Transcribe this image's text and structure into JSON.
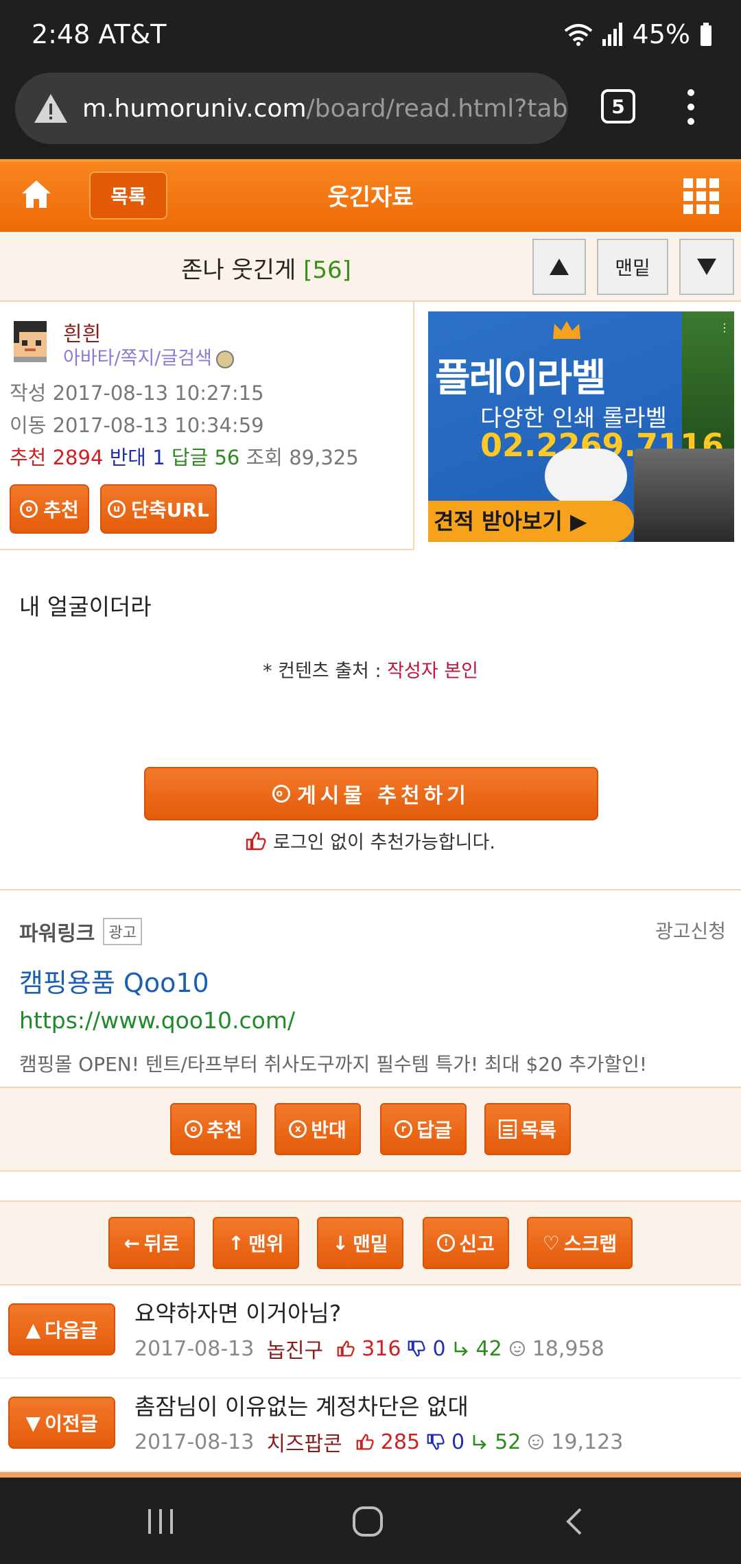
{
  "status": {
    "time": "2:48 AT&T",
    "battery": "45%"
  },
  "browser": {
    "url_host": "m.humoruniv.com",
    "url_path": "/board/read.html?table",
    "tab_count": "5"
  },
  "header": {
    "list_label": "목록",
    "title": "웃긴자료"
  },
  "post": {
    "title": "존나 웃긴게",
    "reply_count": "[56]",
    "nav_bottom": "맨밑",
    "author": "흰흰",
    "author_links": "아바타/쪽지/글검색",
    "created_label": "작성",
    "created": "2017-08-13 10:27:15",
    "moved_label": "이동",
    "moved": "2017-08-13 10:34:59",
    "rec_label": "추천",
    "rec": "2894",
    "opp_label": "반대",
    "opp": "1",
    "reply_label": "답글",
    "reply": "56",
    "views_label": "조회",
    "views": "89,325",
    "btn_recommend": "추천",
    "btn_shorturl": "단축URL",
    "body": "내 얼굴이더라",
    "source_label": "* 컨텐츠 출처 : ",
    "source_value": "작성자 본인",
    "big_recommend": "게시물 추천하기",
    "nologin_note": "로그인 없이 추천가능합니다."
  },
  "ad": {
    "brand": "플레이라벨",
    "sub": "다양한 인쇄 롤라벨",
    "phone": "02.2269.7116",
    "cta": "견적 받아보기 ▶",
    "accent": "#f7a21b"
  },
  "powerlink": {
    "heading": "파워링크",
    "tag": "광고",
    "apply": "광고신청",
    "title": "캠핑용품 Qoo10",
    "url": "https://www.qoo10.com/",
    "desc": "캠핑몰 OPEN! 텐트/타프부터 취사도구까지 필수템 특가! 최대 $20 추가할인!"
  },
  "actions": {
    "recommend": "추천",
    "oppose": "반대",
    "reply": "답글",
    "list": "목록"
  },
  "navbtns": {
    "back": "뒤로",
    "top": "맨위",
    "bottom": "맨밑",
    "report": "신고",
    "scrap": "스크랩"
  },
  "next_post": {
    "label": "다음글",
    "title": "요약하자면 이거아님?",
    "date": "2017-08-13",
    "nick": "놉진구",
    "up": "316",
    "down": "0",
    "replies": "42",
    "views": "18,958"
  },
  "prev_post": {
    "label": "이전글",
    "title": "촘잠님이 이유없는 계정차단은 없대",
    "date": "2017-08-13",
    "nick": "치즈팝콘",
    "up": "285",
    "down": "0",
    "replies": "52",
    "views": "19,123"
  },
  "colors": {
    "brand_orange": "#ee6b08",
    "title_green": "#3a8f1a",
    "link_blue": "#1a5fb4"
  }
}
